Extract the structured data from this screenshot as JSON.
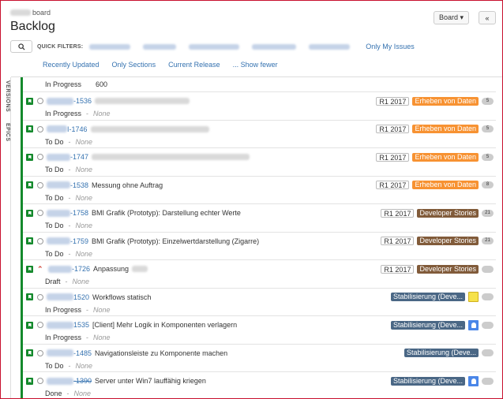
{
  "header": {
    "breadcrumb_suffix": "board",
    "title": "Backlog",
    "board_button": "Board ▾",
    "collapse_button": "«"
  },
  "filters": {
    "label": "QUICK FILTERS:",
    "only_my_issues": "Only My Issues",
    "recently_updated": "Recently Updated",
    "only_sections": "Only Sections",
    "current_release": "Current Release",
    "show_fewer": "... Show fewer"
  },
  "side_tabs": {
    "versions": "VERSIONS",
    "epics": "EPICS"
  },
  "summary_row": {
    "status": "In Progress",
    "count": "600"
  },
  "colors": {
    "epic_orange": "#f79232",
    "epic_brown": "#815b3a",
    "epic_blue": "#4a6785",
    "story_green": "#14892c",
    "link": "#3572b0"
  },
  "issues": [
    {
      "key": "-1536",
      "summary": "",
      "status": "In Progress",
      "assignee": "None",
      "version": "R1 2017",
      "epic": "Erheben von Daten",
      "epic_color": "#f79232",
      "estimate": "5"
    },
    {
      "key": "I-1746",
      "summary": "",
      "status": "To Do",
      "assignee": "None",
      "version": "R1 2017",
      "epic": "Erheben von Daten",
      "epic_color": "#f79232",
      "estimate": "5"
    },
    {
      "key": "-1747",
      "summary": "",
      "status": "To Do",
      "assignee": "None",
      "version": "R1 2017",
      "epic": "Erheben von Daten",
      "epic_color": "#f79232",
      "estimate": "5"
    },
    {
      "key": "-1538",
      "summary": "Messung ohne Auftrag",
      "status": "To Do",
      "assignee": "None",
      "version": "R1 2017",
      "epic": "Erheben von Daten",
      "epic_color": "#f79232",
      "estimate": "8"
    },
    {
      "key": "-1758",
      "summary": "BMI Grafik (Prototyp): Darstellung echter Werte",
      "status": "To Do",
      "assignee": "None",
      "version": "R1 2017",
      "epic": "Developer Stories",
      "epic_color": "#815b3a",
      "estimate": "21"
    },
    {
      "key": "-1759",
      "summary": "BMI Grafik (Prototyp): Einzelwertdarstellung (Zigarre)",
      "status": "To Do",
      "assignee": "None",
      "version": "R1 2017",
      "epic": "Developer Stories",
      "epic_color": "#815b3a",
      "estimate": "21"
    },
    {
      "key": "-1726",
      "summary": "Anpassung",
      "status": "Draft",
      "assignee": "None",
      "version": "R1 2017",
      "epic": "Developer Stories",
      "epic_color": "#815b3a",
      "estimate": "",
      "priority": true
    },
    {
      "key": "1520",
      "summary": "Workflows statisch",
      "status": "In Progress",
      "assignee": "None",
      "version": "",
      "epic": "Stabilisierung (Deve...",
      "epic_color": "#4a6785",
      "estimate": "",
      "avatar": "sponge"
    },
    {
      "key": "1535",
      "summary": "[Client] Mehr Logik in Komponenten verlagern",
      "status": "In Progress",
      "assignee": "None",
      "version": "",
      "epic": "Stabilisierung (Deve...",
      "epic_color": "#4a6785",
      "estimate": "",
      "avatar": "user"
    },
    {
      "key": "-1485",
      "summary": "Navigationsleiste zu Komponente machen",
      "status": "To Do",
      "assignee": "None",
      "version": "",
      "epic": "Stabilisierung (Deve...",
      "epic_color": "#4a6785",
      "estimate": ""
    },
    {
      "key": "-1390",
      "summary": "Server unter Win7 lauffähig kriegen",
      "status": "Done",
      "assignee": "None",
      "version": "",
      "epic": "Stabilisierung (Deve...",
      "epic_color": "#4a6785",
      "estimate": "",
      "avatar": "user",
      "done": true
    }
  ]
}
